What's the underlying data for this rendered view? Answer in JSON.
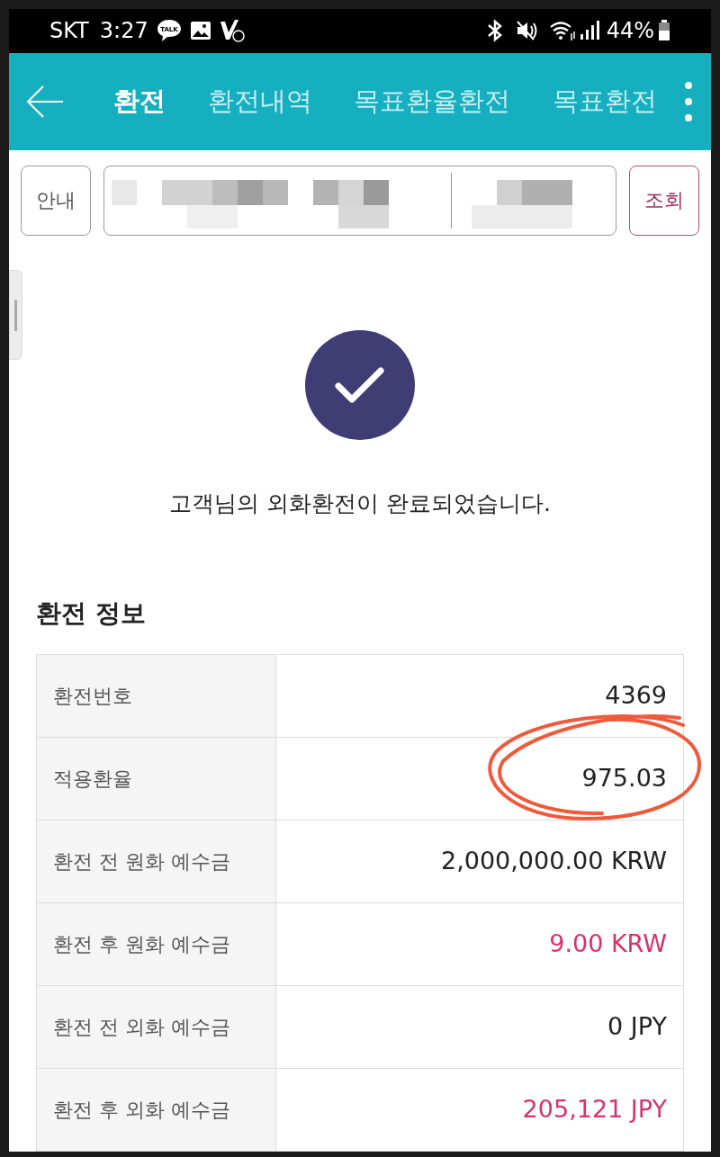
{
  "status_bar": {
    "carrier": "SKT",
    "time": "3:27",
    "talk_badge": "TALK",
    "battery": "44%"
  },
  "tabs": [
    {
      "label": "환전",
      "selected": true
    },
    {
      "label": "환전내역",
      "selected": false
    },
    {
      "label": "목표환율환전",
      "selected": false
    },
    {
      "label": "목표환전",
      "selected": false
    }
  ],
  "toolbar": {
    "info_button": "안내",
    "search_button": "조회"
  },
  "message": "고객님의 외화환전이 완료되었습니다.",
  "section_title": "환전 정보",
  "rows": [
    {
      "label": "환전번호",
      "value": "4369",
      "highlighted": false,
      "circled": false
    },
    {
      "label": "적용환율",
      "value": "975.03",
      "highlighted": false,
      "circled": true
    },
    {
      "label": "환전 전 원화 예수금",
      "value": "2,000,000.00 KRW",
      "highlighted": false,
      "circled": false
    },
    {
      "label": "환전 후 원화 예수금",
      "value": "9.00 KRW",
      "highlighted": true,
      "circled": false
    },
    {
      "label": "환전 전 외화 예수금",
      "value": "0 JPY",
      "highlighted": false,
      "circled": false
    },
    {
      "label": "환전 후 외화 예수금",
      "value": "205,121 JPY",
      "highlighted": true,
      "circled": false
    }
  ]
}
